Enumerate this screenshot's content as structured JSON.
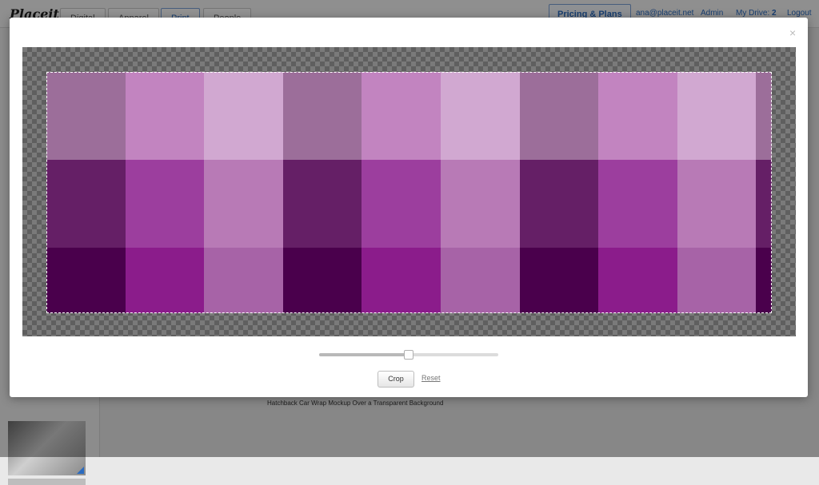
{
  "app": {
    "logo": "Placeit",
    "nav_tabs": [
      "Digital",
      "Apparel",
      "Print",
      "People"
    ],
    "active_tab": "Print",
    "pricing_label": "Pricing & Plans",
    "user_email": "ana@placeit.net",
    "admin_label": "Admin",
    "my_drive_label": "My Drive:",
    "my_drive_count": "2",
    "logout_label": "Logout"
  },
  "background": {
    "caption": "Hatchback Car Wrap Mockup Over a Transparent Background"
  },
  "modal": {
    "close_glyph": "×",
    "image": {
      "rows": [
        [
          "#9c6e9a",
          "#c284c0",
          "#d1a8d1",
          "#9c6e9a",
          "#c284c0",
          "#d1a8d1",
          "#9c6e9a",
          "#c284c0",
          "#d1a8d1",
          "#9c6e9a"
        ],
        [
          "#651f66",
          "#9c3e9e",
          "#b87ab6",
          "#651f66",
          "#9c3e9e",
          "#b87ab6",
          "#651f66",
          "#9c3e9e",
          "#b87ab6",
          "#651f66"
        ],
        [
          "#4a004c",
          "#8b1c8b",
          "#a763a7",
          "#4a004c",
          "#8b1c8b",
          "#a763a7",
          "#4a004c",
          "#8b1c8b",
          "#a763a7",
          "#4a004c"
        ]
      ]
    },
    "zoom_slider_level": 0.5,
    "crop_label": "Crop",
    "reset_label": "Reset"
  }
}
